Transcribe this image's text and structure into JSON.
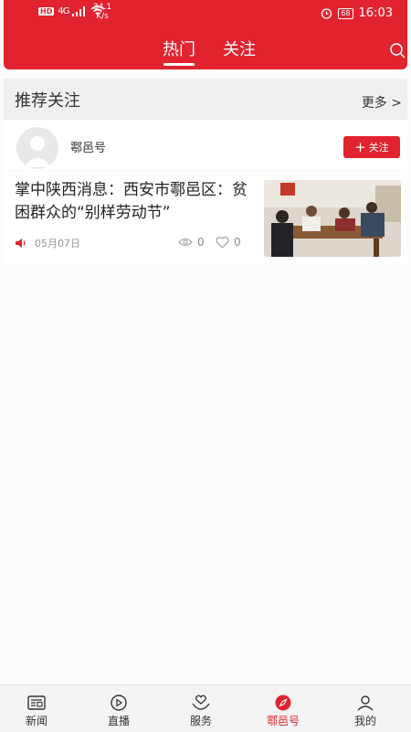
{
  "status_bar": {
    "hd": "HD",
    "network": "4G",
    "speed_value": "34.1",
    "speed_unit": "K/s",
    "battery": "68",
    "time": "16:03"
  },
  "header": {
    "tabs": [
      {
        "label": "热门",
        "active": true
      },
      {
        "label": "关注",
        "active": false
      }
    ]
  },
  "recommend": {
    "title": "推荐关注",
    "more_label": "更多 >"
  },
  "account": {
    "name": "鄠邑号",
    "follow_label": "关注"
  },
  "article": {
    "title": "掌中陕西消息：西安市鄠邑区：贫困群众的“别样劳动节”",
    "date": "05月07日",
    "views": "0",
    "likes": "0"
  },
  "bottom_nav": [
    {
      "label": "新闻",
      "icon": "news-icon",
      "active": false
    },
    {
      "label": "直播",
      "icon": "live-play-icon",
      "active": false
    },
    {
      "label": "服务",
      "icon": "service-heart-icon",
      "active": false
    },
    {
      "label": "鄠邑号",
      "icon": "compass-icon",
      "active": true
    },
    {
      "label": "我的",
      "icon": "profile-icon",
      "active": false
    }
  ],
  "colors": {
    "brand_red": "#e1232f",
    "background": "#fbfbfb"
  }
}
